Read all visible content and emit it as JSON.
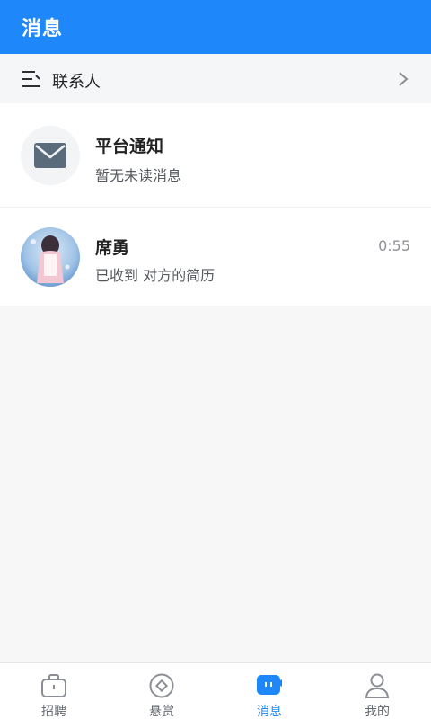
{
  "header": {
    "title": "消息"
  },
  "contacts": {
    "label": "联系人",
    "icon": "contacts-list-icon",
    "chevron": "chevron-right-icon"
  },
  "messages": [
    {
      "title": "平台通知",
      "subtitle": "暂无未读消息",
      "time": "",
      "avatar": "mail-icon"
    },
    {
      "title": "席勇",
      "subtitle": "已收到 对方的简历",
      "time": "0:55",
      "avatar": "user-photo"
    }
  ],
  "tabs": [
    {
      "label": "招聘",
      "icon": "briefcase-icon",
      "active": false
    },
    {
      "label": "悬赏",
      "icon": "reward-icon",
      "active": false
    },
    {
      "label": "消息",
      "icon": "chat-icon",
      "active": true
    },
    {
      "label": "我的",
      "icon": "profile-icon",
      "active": false
    }
  ],
  "colors": {
    "brand": "#1e88fb",
    "background": "#f7f7f8",
    "text": "#222222",
    "muted": "#8e9196"
  }
}
